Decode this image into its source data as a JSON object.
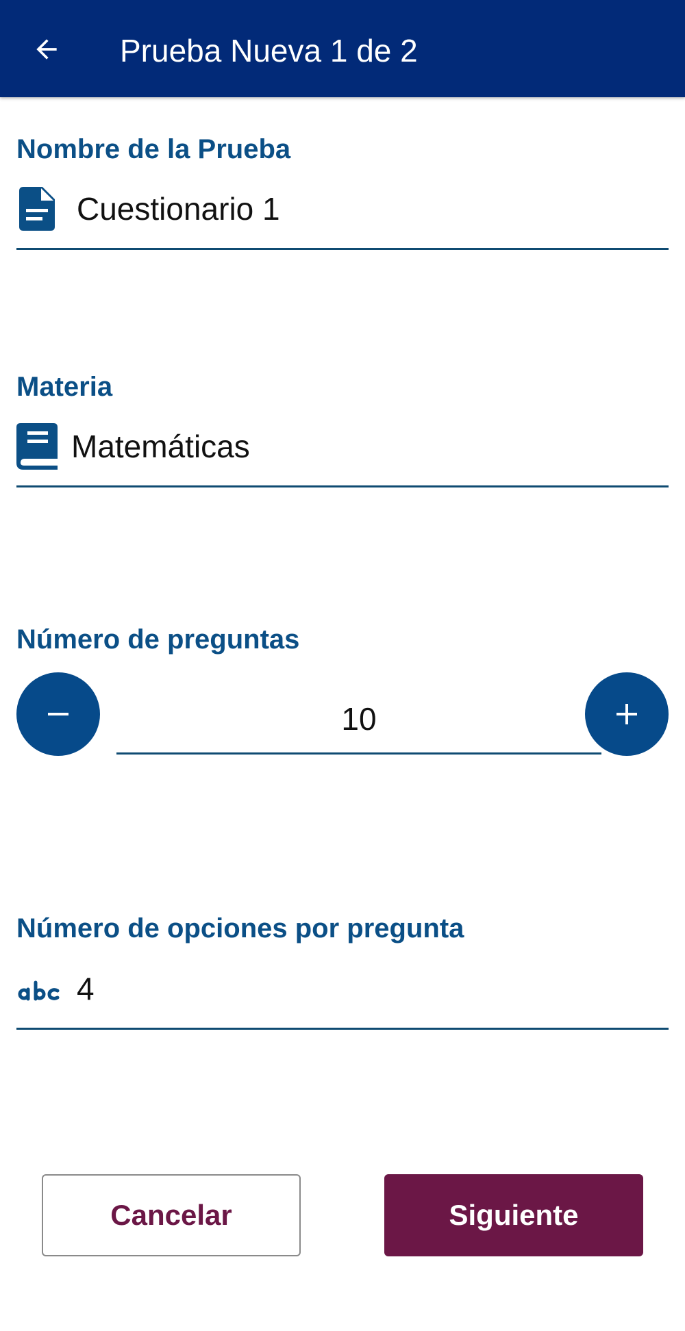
{
  "appbar": {
    "title": "Prueba Nueva 1 de 2",
    "back_icon": "arrow-left-icon",
    "background": "#022a78"
  },
  "form": {
    "test_name": {
      "label": "Nombre de la Prueba",
      "value": "Cuestionario 1",
      "icon": "document-icon"
    },
    "subject": {
      "label": "Materia",
      "value": "Matemáticas",
      "icon": "book-icon"
    },
    "question_count": {
      "label": "Número de preguntas",
      "value": "10",
      "decrement_icon": "minus-icon",
      "increment_icon": "plus-icon"
    },
    "options_per_question": {
      "label": "Número de opciones por pregunta",
      "value": "4",
      "icon": "abc-icon"
    }
  },
  "actions": {
    "cancel_label": "Cancelar",
    "next_label": "Siguiente"
  },
  "colors": {
    "label": "#0b4f86",
    "accent_button": "#6b1746",
    "stepper_button": "#064a8a",
    "underline": "#0f4b72"
  }
}
